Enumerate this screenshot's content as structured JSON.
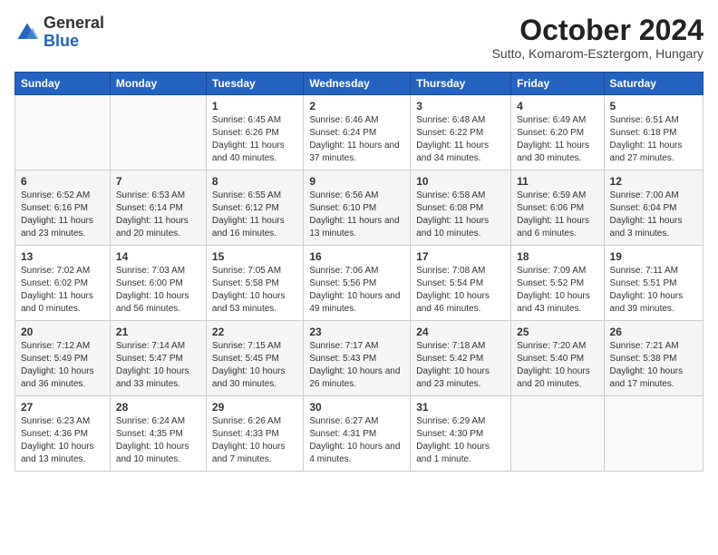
{
  "logo": {
    "general": "General",
    "blue": "Blue"
  },
  "title": "October 2024",
  "subtitle": "Sutto, Komarom-Esztergom, Hungary",
  "headers": [
    "Sunday",
    "Monday",
    "Tuesday",
    "Wednesday",
    "Thursday",
    "Friday",
    "Saturday"
  ],
  "weeks": [
    [
      {
        "num": "",
        "info": ""
      },
      {
        "num": "",
        "info": ""
      },
      {
        "num": "1",
        "info": "Sunrise: 6:45 AM\nSunset: 6:26 PM\nDaylight: 11 hours and 40 minutes."
      },
      {
        "num": "2",
        "info": "Sunrise: 6:46 AM\nSunset: 6:24 PM\nDaylight: 11 hours and 37 minutes."
      },
      {
        "num": "3",
        "info": "Sunrise: 6:48 AM\nSunset: 6:22 PM\nDaylight: 11 hours and 34 minutes."
      },
      {
        "num": "4",
        "info": "Sunrise: 6:49 AM\nSunset: 6:20 PM\nDaylight: 11 hours and 30 minutes."
      },
      {
        "num": "5",
        "info": "Sunrise: 6:51 AM\nSunset: 6:18 PM\nDaylight: 11 hours and 27 minutes."
      }
    ],
    [
      {
        "num": "6",
        "info": "Sunrise: 6:52 AM\nSunset: 6:16 PM\nDaylight: 11 hours and 23 minutes."
      },
      {
        "num": "7",
        "info": "Sunrise: 6:53 AM\nSunset: 6:14 PM\nDaylight: 11 hours and 20 minutes."
      },
      {
        "num": "8",
        "info": "Sunrise: 6:55 AM\nSunset: 6:12 PM\nDaylight: 11 hours and 16 minutes."
      },
      {
        "num": "9",
        "info": "Sunrise: 6:56 AM\nSunset: 6:10 PM\nDaylight: 11 hours and 13 minutes."
      },
      {
        "num": "10",
        "info": "Sunrise: 6:58 AM\nSunset: 6:08 PM\nDaylight: 11 hours and 10 minutes."
      },
      {
        "num": "11",
        "info": "Sunrise: 6:59 AM\nSunset: 6:06 PM\nDaylight: 11 hours and 6 minutes."
      },
      {
        "num": "12",
        "info": "Sunrise: 7:00 AM\nSunset: 6:04 PM\nDaylight: 11 hours and 3 minutes."
      }
    ],
    [
      {
        "num": "13",
        "info": "Sunrise: 7:02 AM\nSunset: 6:02 PM\nDaylight: 11 hours and 0 minutes."
      },
      {
        "num": "14",
        "info": "Sunrise: 7:03 AM\nSunset: 6:00 PM\nDaylight: 10 hours and 56 minutes."
      },
      {
        "num": "15",
        "info": "Sunrise: 7:05 AM\nSunset: 5:58 PM\nDaylight: 10 hours and 53 minutes."
      },
      {
        "num": "16",
        "info": "Sunrise: 7:06 AM\nSunset: 5:56 PM\nDaylight: 10 hours and 49 minutes."
      },
      {
        "num": "17",
        "info": "Sunrise: 7:08 AM\nSunset: 5:54 PM\nDaylight: 10 hours and 46 minutes."
      },
      {
        "num": "18",
        "info": "Sunrise: 7:09 AM\nSunset: 5:52 PM\nDaylight: 10 hours and 43 minutes."
      },
      {
        "num": "19",
        "info": "Sunrise: 7:11 AM\nSunset: 5:51 PM\nDaylight: 10 hours and 39 minutes."
      }
    ],
    [
      {
        "num": "20",
        "info": "Sunrise: 7:12 AM\nSunset: 5:49 PM\nDaylight: 10 hours and 36 minutes."
      },
      {
        "num": "21",
        "info": "Sunrise: 7:14 AM\nSunset: 5:47 PM\nDaylight: 10 hours and 33 minutes."
      },
      {
        "num": "22",
        "info": "Sunrise: 7:15 AM\nSunset: 5:45 PM\nDaylight: 10 hours and 30 minutes."
      },
      {
        "num": "23",
        "info": "Sunrise: 7:17 AM\nSunset: 5:43 PM\nDaylight: 10 hours and 26 minutes."
      },
      {
        "num": "24",
        "info": "Sunrise: 7:18 AM\nSunset: 5:42 PM\nDaylight: 10 hours and 23 minutes."
      },
      {
        "num": "25",
        "info": "Sunrise: 7:20 AM\nSunset: 5:40 PM\nDaylight: 10 hours and 20 minutes."
      },
      {
        "num": "26",
        "info": "Sunrise: 7:21 AM\nSunset: 5:38 PM\nDaylight: 10 hours and 17 minutes."
      }
    ],
    [
      {
        "num": "27",
        "info": "Sunrise: 6:23 AM\nSunset: 4:36 PM\nDaylight: 10 hours and 13 minutes."
      },
      {
        "num": "28",
        "info": "Sunrise: 6:24 AM\nSunset: 4:35 PM\nDaylight: 10 hours and 10 minutes."
      },
      {
        "num": "29",
        "info": "Sunrise: 6:26 AM\nSunset: 4:33 PM\nDaylight: 10 hours and 7 minutes."
      },
      {
        "num": "30",
        "info": "Sunrise: 6:27 AM\nSunset: 4:31 PM\nDaylight: 10 hours and 4 minutes."
      },
      {
        "num": "31",
        "info": "Sunrise: 6:29 AM\nSunset: 4:30 PM\nDaylight: 10 hours and 1 minute."
      },
      {
        "num": "",
        "info": ""
      },
      {
        "num": "",
        "info": ""
      }
    ]
  ]
}
